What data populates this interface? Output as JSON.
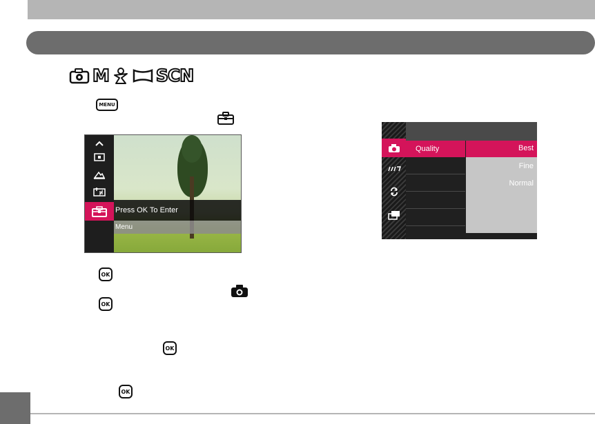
{
  "mode_icons": [
    "camera-auto-icon",
    "M",
    "scene-portrait-icon",
    "panorama-icon",
    "SCN"
  ],
  "keys": {
    "menu_label": "MENU",
    "ok_label": "OK"
  },
  "left_screen": {
    "rail_icons": [
      "chevron-up-icon",
      "single-shot-icon",
      "landscape-icon",
      "date-stamp-icon",
      "setup-toolbox-icon"
    ],
    "banner_text": "Press OK To Enter",
    "sub_banner_text": "Menu"
  },
  "right_screen": {
    "rail_icons": [
      "camera-icon",
      "burst-icon",
      "refresh-icon",
      "playback-settings-icon"
    ],
    "selected_item": "Quality",
    "options": [
      "Best",
      "Fine",
      "Normal"
    ],
    "selected_option": "Best"
  },
  "colors": {
    "accent": "#d4145a",
    "pill": "#6d6d6d",
    "bar": "#b5b5b5"
  }
}
